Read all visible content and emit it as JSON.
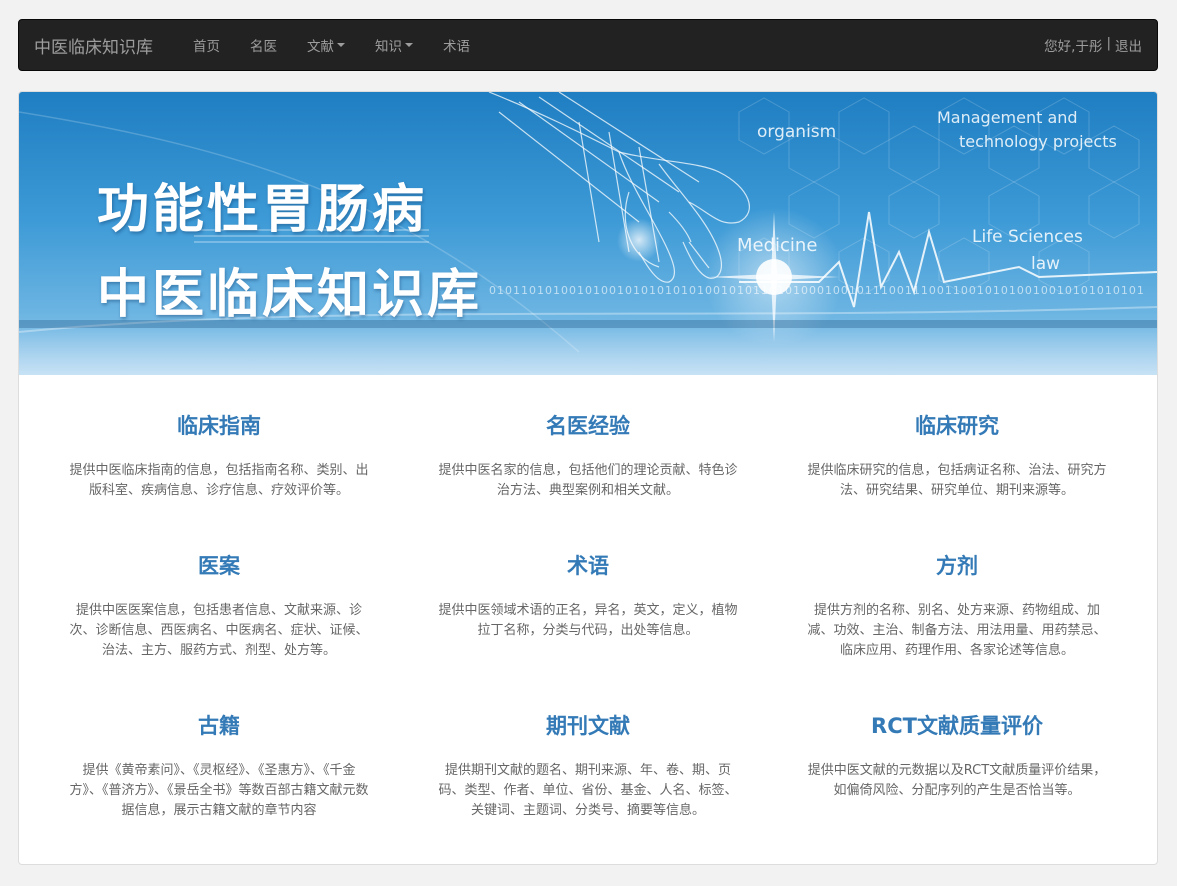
{
  "navbar": {
    "brand": "中医临床知识库",
    "items": [
      {
        "label": "首页",
        "dropdown": false
      },
      {
        "label": "名医",
        "dropdown": false
      },
      {
        "label": "文献",
        "dropdown": true
      },
      {
        "label": "知识",
        "dropdown": true
      },
      {
        "label": "术语",
        "dropdown": false
      }
    ],
    "greeting": "您好,于彤",
    "separator": "|",
    "logout": "退出"
  },
  "banner": {
    "title_line1": "功能性胃肠病",
    "title_line2": "中医临床知识库",
    "deco_organism": "organism",
    "deco_management": "Management and",
    "deco_technology": "technology projects",
    "deco_medicine": "Medicine",
    "deco_life": "Life Sciences",
    "deco_law": "law",
    "binary": "0101101010010100101010101010010101101010001001011100111001100101010010010101010101"
  },
  "features": [
    {
      "title": "临床指南",
      "desc": "提供中医临床指南的信息，包括指南名称、类别、出版科室、疾病信息、诊疗信息、疗效评价等。"
    },
    {
      "title": "名医经验",
      "desc": "提供中医名家的信息，包括他们的理论贡献、特色诊治方法、典型案例和相关文献。"
    },
    {
      "title": "临床研究",
      "desc": "提供临床研究的信息，包括病证名称、治法、研究方法、研究结果、研究单位、期刊来源等。"
    },
    {
      "title": "医案",
      "desc": "提供中医医案信息，包括患者信息、文献来源、诊次、诊断信息、西医病名、中医病名、症状、证候、治法、主方、服药方式、剂型、处方等。"
    },
    {
      "title": "术语",
      "desc": "提供中医领域术语的正名，异名，英文，定义，植物拉丁名称，分类与代码，出处等信息。"
    },
    {
      "title": "方剂",
      "desc": "提供方剂的名称、别名、处方来源、药物组成、加减、功效、主治、制备方法、用法用量、用药禁忌、临床应用、药理作用、各家论述等信息。"
    },
    {
      "title": "古籍",
      "desc": "提供《黄帝素问》、《灵枢经》、《圣惠方》、《千金方》、《普济方》、《景岳全书》等数百部古籍文献元数据信息，展示古籍文献的章节内容"
    },
    {
      "title": "期刊文献",
      "desc": "提供期刊文献的题名、期刊来源、年、卷、期、页码、类型、作者、单位、省份、基金、人名、标签、关键词、主题词、分类号、摘要等信息。"
    },
    {
      "title": "RCT文献质量评价",
      "desc": "提供中医文献的元数据以及RCT文献质量评价结果，如偏倚风险、分配序列的产生是否恰当等。"
    }
  ]
}
